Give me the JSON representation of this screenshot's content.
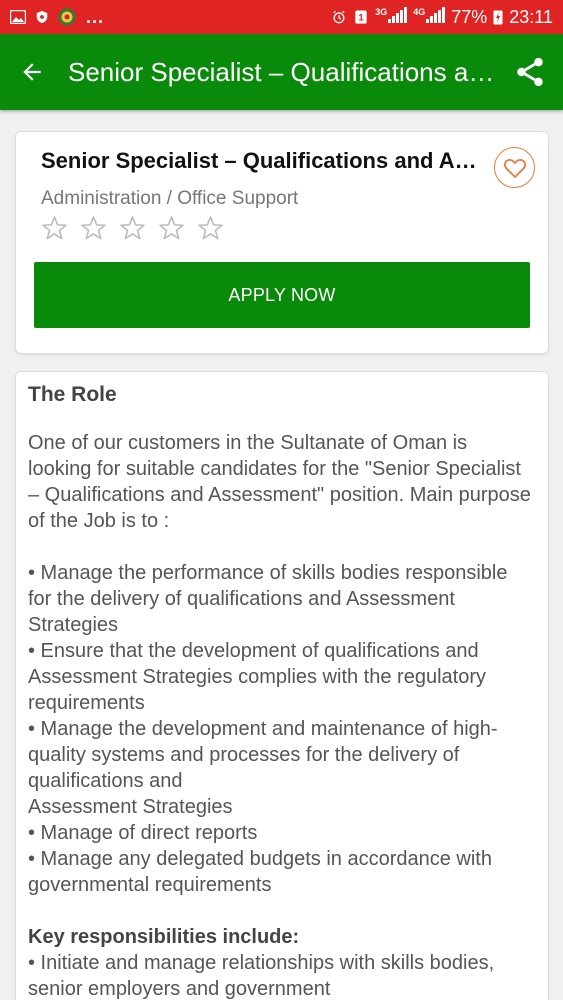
{
  "status_bar": {
    "notifications": "...",
    "net_3g": "3G",
    "net_4g": "4G",
    "battery": "77%",
    "time": "23:11"
  },
  "app_bar": {
    "title": "Senior Specialist – Qualifications and Assessment",
    "back_icon": "arrow-back-icon",
    "share_icon": "share-icon"
  },
  "job": {
    "title": "Senior Specialist – Qualifications and Assessment",
    "category": "Administration / Office Support",
    "rating": 0,
    "rating_max": 5,
    "apply_label": "APPLY NOW",
    "favorite_icon": "heart-outline-icon"
  },
  "description": {
    "heading": "The Role",
    "intro": "One of our customers in the Sultanate of Oman is looking for suitable candidates for the \"Senior Specialist – Qualifications and Assessment\" position. Main purpose of the Job is to :",
    "purpose_items": [
      "• Manage the performance of skills bodies responsible for the delivery of qualifications and Assessment Strategies",
      "• Ensure that the development of qualifications and Assessment Strategies complies with the regulatory requirements",
      "• Manage the development and maintenance of high-quality systems and processes for the delivery of qualifications and",
      "Assessment Strategies",
      "• Manage of direct reports",
      "• Manage any delegated budgets in accordance with governmental requirements"
    ],
    "responsibilities_heading": "Key responsibilities include:",
    "responsibilities_items": [
      "• Initiate and manage relationships with skills bodies, senior employers and government"
    ]
  },
  "colors": {
    "status_bar": "#e02424",
    "app_bar": "#0a8a0a",
    "apply_button": "#0a8a0a",
    "favorite_accent": "#e87a3a"
  }
}
